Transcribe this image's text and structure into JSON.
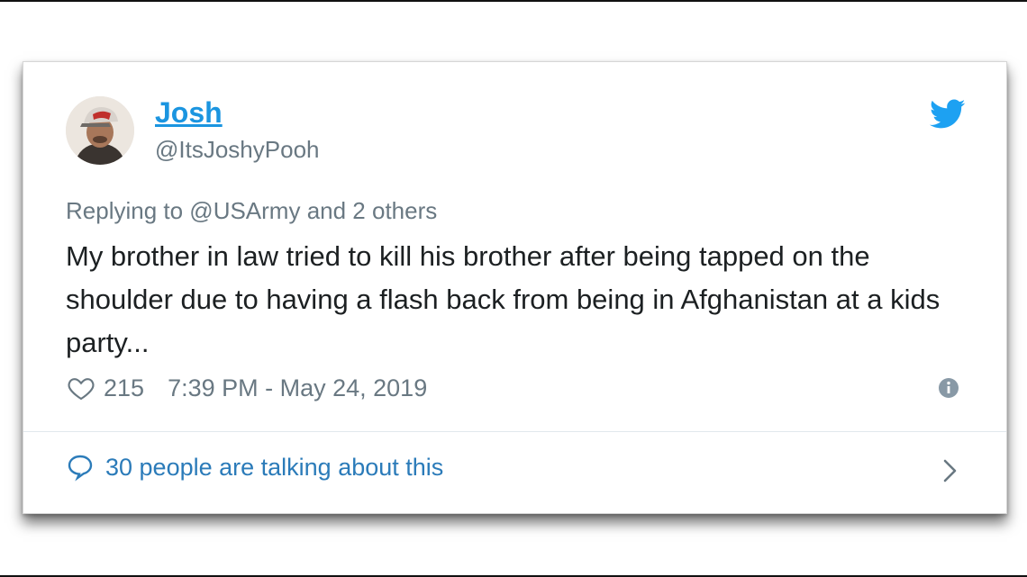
{
  "tweet": {
    "author_name": "Josh",
    "author_handle": "@ItsJoshyPooh",
    "reply_context": "Replying to @USArmy and 2 others",
    "text": "My brother in law tried to kill his brother after being tapped on the shoulder due to having a flash back from being in Afghanistan at a kids party...",
    "likes": "215",
    "timestamp": "7:39 PM - May 24, 2019",
    "conversation_link": "30 people are talking about this"
  },
  "icons": {
    "brand": "twitter-bird-icon",
    "like": "heart-icon",
    "info": "info-icon",
    "conversation": "speech-bubble-icon",
    "expand": "chevron-right-icon"
  },
  "colors": {
    "link_blue": "#1b95e0",
    "conversation_blue": "#2b7bb9",
    "muted_gray": "#697882",
    "text_dark": "#1c2022",
    "twitter_blue": "#1da1f2"
  }
}
